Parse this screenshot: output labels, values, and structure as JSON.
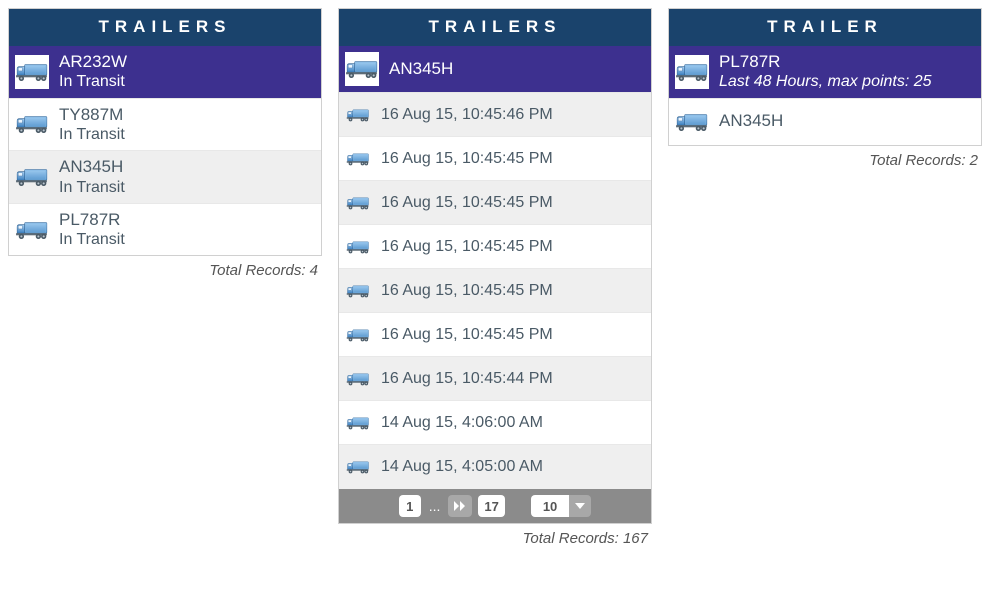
{
  "panel1": {
    "title": "TRAILERS",
    "rows": [
      {
        "id": "AR232W",
        "status": "In Transit",
        "selected": true
      },
      {
        "id": "TY887M",
        "status": "In Transit",
        "selected": false
      },
      {
        "id": "AN345H",
        "status": "In Transit",
        "selected": false
      },
      {
        "id": "PL787R",
        "status": "In Transit",
        "selected": false
      }
    ],
    "total_label": "Total Records: 4"
  },
  "panel2": {
    "title": "TRAILERS",
    "selected_id": "AN345H",
    "rows": [
      "16 Aug 15, 10:45:46 PM",
      "16 Aug 15, 10:45:45 PM",
      "16 Aug 15, 10:45:45 PM",
      "16 Aug 15, 10:45:45 PM",
      "16 Aug 15, 10:45:45 PM",
      "16 Aug 15, 10:45:45 PM",
      "16 Aug 15, 10:45:44 PM",
      "14 Aug 15, 4:06:00 AM",
      "14 Aug 15, 4:05:00 AM"
    ],
    "pager": {
      "current": "1",
      "ellipsis": "...",
      "last": "17",
      "page_size": "10"
    },
    "total_label": "Total Records: 167"
  },
  "panel3": {
    "title": "TRAILER",
    "rows": [
      {
        "id": "PL787R",
        "sub": "Last 48 Hours, max points: 25",
        "selected": true,
        "italic": true
      },
      {
        "id": "AN345H",
        "sub": "",
        "selected": false,
        "italic": false
      }
    ],
    "total_label": "Total Records: 2"
  }
}
